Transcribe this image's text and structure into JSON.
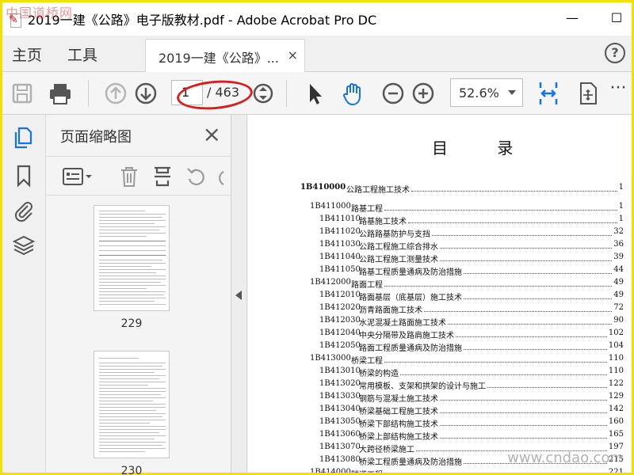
{
  "window": {
    "title": "2019一建《公路》电子版教材.pdf - Adobe Acrobat Pro DC",
    "minimize_label": "—",
    "maximize_label": "☐",
    "app_icon_glyph": "✎",
    "watermark_top_left": "中国道桥网"
  },
  "menubar": {
    "home_label": "主页",
    "tools_label": "工具",
    "tab_label": "2019一建《公路》...",
    "tab_close": "×",
    "help_label": "?"
  },
  "toolbar": {
    "page_current": "1",
    "page_total": "/ 463",
    "zoom": "52.6%",
    "more": "···"
  },
  "thumbnails_panel": {
    "title": "页面缩略图",
    "close": "×",
    "thumbs": [
      {
        "label": "229"
      },
      {
        "label": "230"
      }
    ]
  },
  "document": {
    "toc_title": "目  录",
    "rows": [
      {
        "code": "1B410000",
        "text": "公路工程施工技术",
        "page": "1",
        "level": 0
      },
      {
        "code": "1B411000",
        "text": "路基工程",
        "page": "1",
        "level": 1
      },
      {
        "code": "1B411010",
        "text": "路基施工技术",
        "page": "1",
        "level": 2
      },
      {
        "code": "1B411020",
        "text": "公路路基防护与支挡",
        "page": "32",
        "level": 2
      },
      {
        "code": "1B411030",
        "text": "公路工程施工综合排水",
        "page": "36",
        "level": 2
      },
      {
        "code": "1B411040",
        "text": "公路工程施工测量技术",
        "page": "39",
        "level": 2
      },
      {
        "code": "1B411050",
        "text": "路基工程质量通病及防治措施",
        "page": "44",
        "level": 2
      },
      {
        "code": "1B412000",
        "text": "路面工程",
        "page": "49",
        "level": 1
      },
      {
        "code": "1B412010",
        "text": "路面基层（底基层）施工技术",
        "page": "49",
        "level": 2
      },
      {
        "code": "1B412020",
        "text": "沥青路面施工技术",
        "page": "72",
        "level": 2
      },
      {
        "code": "1B412030",
        "text": "水泥混凝土路面施工技术",
        "page": "90",
        "level": 2
      },
      {
        "code": "1B412040",
        "text": "中央分隔带及路肩施工技术",
        "page": "102",
        "level": 2
      },
      {
        "code": "1B412050",
        "text": "路面工程质量通病及防治措施",
        "page": "104",
        "level": 2
      },
      {
        "code": "1B413000",
        "text": "桥梁工程",
        "page": "110",
        "level": 1
      },
      {
        "code": "1B413010",
        "text": "桥梁的构造",
        "page": "110",
        "level": 2
      },
      {
        "code": "1B413020",
        "text": "常用模板、支架和拱架的设计与施工",
        "page": "122",
        "level": 2
      },
      {
        "code": "1B413030",
        "text": "钢筋与混凝土施工技术",
        "page": "129",
        "level": 2
      },
      {
        "code": "1B413040",
        "text": "桥梁基础工程施工技术",
        "page": "142",
        "level": 2
      },
      {
        "code": "1B413050",
        "text": "桥梁下部结构施工技术",
        "page": "160",
        "level": 2
      },
      {
        "code": "1B413060",
        "text": "桥梁上部结构施工技术",
        "page": "165",
        "level": 2
      },
      {
        "code": "1B413070",
        "text": "大跨径桥梁施工",
        "page": "197",
        "level": 2
      },
      {
        "code": "1B413080",
        "text": "桥梁工程质量通病及防治措施",
        "page": "215",
        "level": 2
      },
      {
        "code": "1B414000",
        "text": "隧道工程",
        "page": "221",
        "level": 1
      }
    ],
    "watermark_bottom_right": "www.cndao.com"
  }
}
